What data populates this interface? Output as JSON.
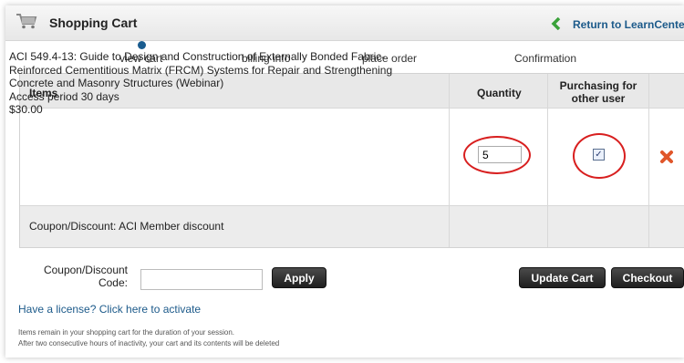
{
  "header": {
    "title": "Shopping Cart",
    "return_link": "Return to LearnCenter"
  },
  "steps": [
    {
      "label": "view cart",
      "active": true
    },
    {
      "label": "billing info",
      "active": false
    },
    {
      "label": "place order",
      "active": false
    },
    {
      "label": "Confirmation",
      "active": false
    }
  ],
  "table": {
    "columns": {
      "items": "Items",
      "quantity": "Quantity",
      "purchasing_line1": "Purchasing for",
      "purchasing_line2": "other user"
    },
    "item": {
      "line1": "ACI 549.4-13: Guide to Design and Construction of Externally Bonded Fabric-",
      "line2": "Reinforced Cementitious Matrix (FRCM) Systems for Repair and Strengthening",
      "line3": "Concrete and Masonry Structures (Webinar)",
      "access": "Access period 30 days",
      "price": "$30.00",
      "quantity": "5",
      "purchasing_for_other": true
    },
    "coupon_row": "Coupon/Discount: ACI Member discount"
  },
  "coupon_form": {
    "label_line1": "Coupon/Discount",
    "label_line2": "Code:",
    "code_value": "",
    "apply_label": "Apply"
  },
  "actions": {
    "update_label": "Update Cart",
    "checkout_label": "Checkout"
  },
  "license_link": "Have a license? Click here to activate",
  "notes": {
    "line1": "Items remain in your shopping cart for the duration of your session.",
    "line2": "After two consecutive hours of inactivity, your cart and its contents will be deleted"
  },
  "colors": {
    "link": "#1c5a8a",
    "highlight_circle": "#d81f1f",
    "active_step_dot": "#1a5c8f",
    "return_arrow": "#3aa23a",
    "remove_icon": "#e0562a"
  },
  "icons": {
    "cart": "shopping-cart-icon",
    "return": "arrow-left-icon",
    "remove": "remove-x-icon"
  }
}
